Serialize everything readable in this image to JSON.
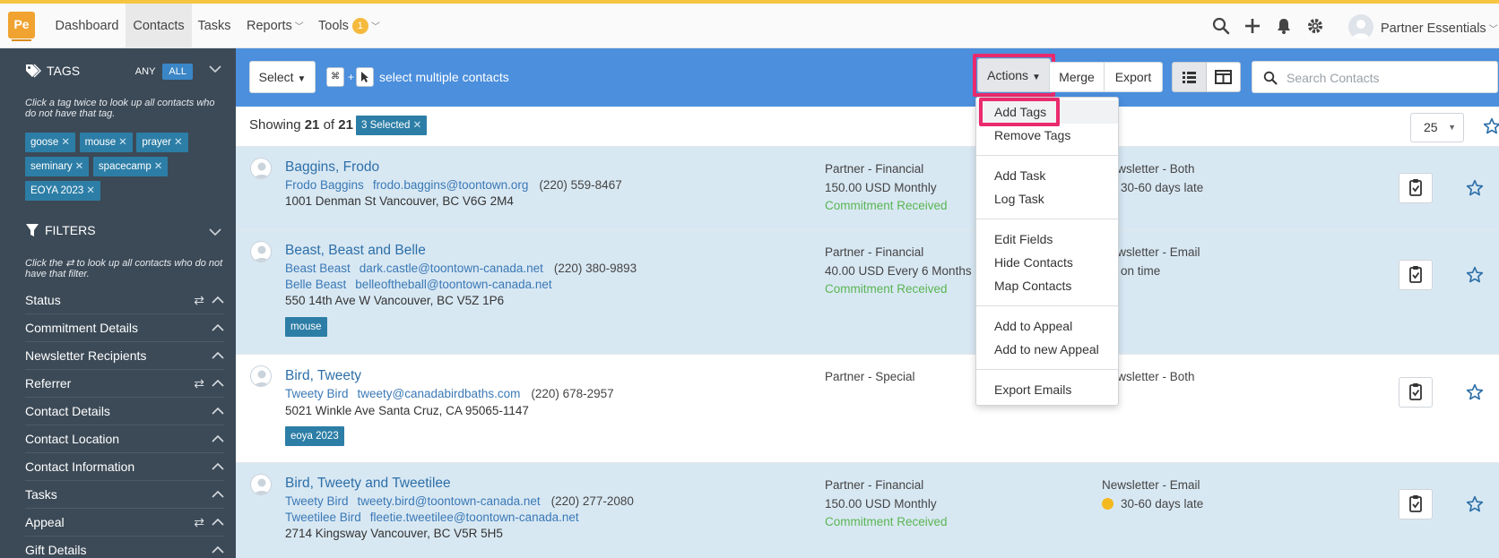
{
  "nav": {
    "logo": "Pe",
    "items": [
      "Dashboard",
      "Contacts",
      "Tasks",
      "Reports",
      "Tools"
    ],
    "tools_badge": "1",
    "user_name": "Partner Essentials"
  },
  "sidebar": {
    "tags_header": "TAGS",
    "any_label": "ANY",
    "all_label": "ALL",
    "tags_hint": "Click a tag twice to look up all contacts who do not have that tag.",
    "tags": [
      "goose",
      "mouse",
      "prayer",
      "seminary",
      "spacecamp",
      "EOYA 2023"
    ],
    "filters_header": "FILTERS",
    "filters_hint": "Click the ⇄ to look up all contacts who do not have that filter.",
    "filters": [
      {
        "label": "Status",
        "reversible": true
      },
      {
        "label": "Commitment Details",
        "reversible": false
      },
      {
        "label": "Newsletter Recipients",
        "reversible": false
      },
      {
        "label": "Referrer",
        "reversible": true
      },
      {
        "label": "Contact Details",
        "reversible": false
      },
      {
        "label": "Contact Location",
        "reversible": false
      },
      {
        "label": "Contact Information",
        "reversible": false
      },
      {
        "label": "Tasks",
        "reversible": false
      },
      {
        "label": "Appeal",
        "reversible": true
      },
      {
        "label": "Gift Details",
        "reversible": false
      }
    ]
  },
  "toolbar": {
    "select_label": "Select",
    "key_cmd": "⌘",
    "plus": "+",
    "multi_text": "select multiple contacts",
    "actions_label": "Actions",
    "merge_label": "Merge",
    "export_label": "Export",
    "search_placeholder": "Search Contacts"
  },
  "countbar": {
    "showing_prefix": "Showing",
    "shown": "21",
    "of_word": "of",
    "total": "21",
    "selected": "3 Selected",
    "per_page": "25"
  },
  "contacts": [
    {
      "name": "Baggins, Frodo",
      "people": [
        {
          "name": "Frodo Baggins",
          "email": "frodo.baggins@toontown.org",
          "phone": "(220) 559-8467"
        }
      ],
      "address": "1001 Denman St Vancouver, BC V6G 2M4",
      "tag": "",
      "status": "Partner - Financial",
      "pledge": "150.00 USD Monthly",
      "commitment": "Commitment Received",
      "newsletter": "Newsletter - Both",
      "late": "30-60 days late"
    },
    {
      "name": "Beast, Beast and Belle",
      "people": [
        {
          "name": "Beast Beast",
          "email": "dark.castle@toontown-canada.net",
          "phone": "(220) 380-9893"
        },
        {
          "name": "Belle Beast",
          "email": "belleoftheball@toontown-canada.net",
          "phone": ""
        }
      ],
      "address": "550 14th Ave W Vancouver, BC V5Z 1P6",
      "tag": "mouse",
      "status": "Partner - Financial",
      "pledge": "40.00 USD Every 6 Months",
      "commitment": "Commitment Received",
      "newsletter": "Newsletter - Email",
      "late": "on time"
    },
    {
      "name": "Bird, Tweety",
      "people": [
        {
          "name": "Tweety Bird",
          "email": "tweety@canadabirdbaths.com",
          "phone": "(220) 678-2957"
        }
      ],
      "address": "5021 Winkle Ave Santa Cruz, CA 95065-1147",
      "tag": "eoya 2023",
      "status": "Partner - Special",
      "pledge": "",
      "commitment": "",
      "newsletter": "Newsletter - Both",
      "late": ""
    },
    {
      "name": "Bird, Tweety and Tweetilee",
      "people": [
        {
          "name": "Tweety Bird",
          "email": "tweety.bird@toontown-canada.net",
          "phone": "(220) 277-2080"
        },
        {
          "name": "Tweetilee Bird",
          "email": "fleetie.tweetilee@toontown-canada.net",
          "phone": ""
        }
      ],
      "address": "2714 Kingsway Vancouver, BC V5R 5H5",
      "tag": "",
      "status": "Partner - Financial",
      "pledge": "150.00 USD Monthly",
      "commitment": "Commitment Received",
      "newsletter": "Newsletter - Email",
      "late": "30-60 days late"
    }
  ],
  "actions_menu": {
    "groups": [
      [
        "Add Tags",
        "Remove Tags"
      ],
      [
        "Add Task",
        "Log Task"
      ],
      [
        "Edit Fields",
        "Hide Contacts",
        "Map Contacts"
      ],
      [
        "Add to Appeal",
        "Add to new Appeal"
      ],
      [
        "Export Emails"
      ]
    ]
  },
  "colors": {
    "toolbar_blue": "#4b8fdd",
    "sidebar": "#3c4a57",
    "tag": "#2d7ea6",
    "highlight": "#ea2a6c",
    "selected_row": "#d8e8f3",
    "commitment_green": "#5ab552",
    "late_dot": "#f3b91f"
  }
}
